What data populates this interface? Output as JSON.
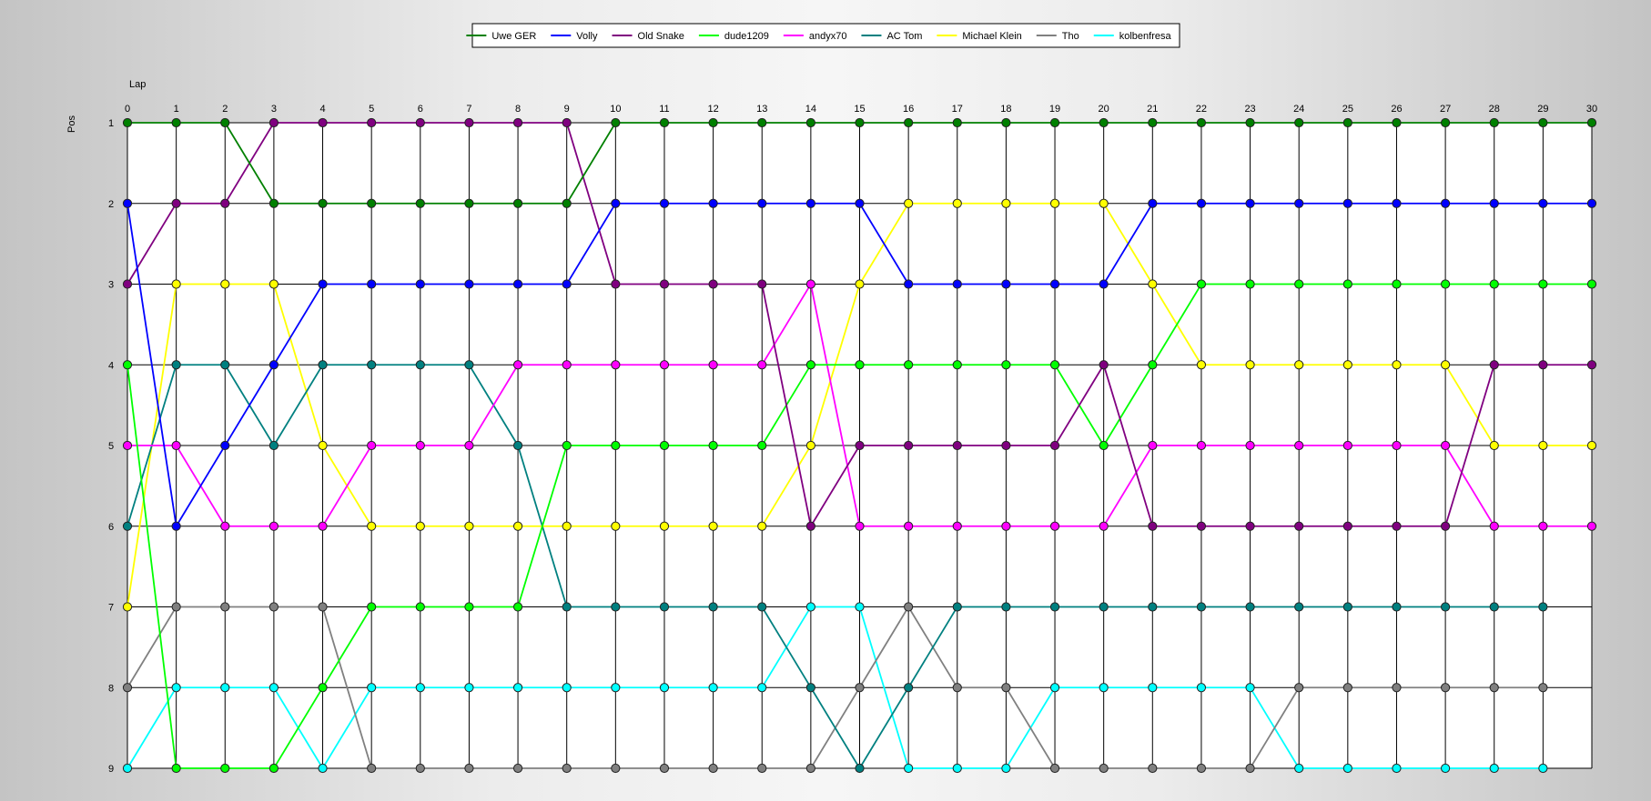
{
  "chart_data": {
    "type": "line",
    "xlabel": "Lap",
    "ylabel": "Pos",
    "x": [
      0,
      1,
      2,
      3,
      4,
      5,
      6,
      7,
      8,
      9,
      10,
      11,
      12,
      13,
      14,
      15,
      16,
      17,
      18,
      19,
      20,
      21,
      22,
      23,
      24,
      25,
      26,
      27,
      28,
      29,
      30
    ],
    "xlim": [
      0,
      30
    ],
    "ylim": [
      1,
      9
    ],
    "y_inverted": true,
    "yticks": [
      1,
      2,
      3,
      4,
      5,
      6,
      7,
      8,
      9
    ],
    "grid": true,
    "legend_position": "top-center",
    "series": [
      {
        "name": "Uwe GER",
        "color": "#008000",
        "values": [
          1,
          1,
          1,
          2,
          2,
          2,
          2,
          2,
          2,
          2,
          1,
          1,
          1,
          1,
          1,
          1,
          1,
          1,
          1,
          1,
          1,
          1,
          1,
          1,
          1,
          1,
          1,
          1,
          1,
          1,
          1
        ]
      },
      {
        "name": "Volly",
        "color": "#0000ff",
        "values": [
          2,
          6,
          5,
          4,
          3,
          3,
          3,
          3,
          3,
          3,
          2,
          2,
          2,
          2,
          2,
          2,
          3,
          3,
          3,
          3,
          3,
          2,
          2,
          2,
          2,
          2,
          2,
          2,
          2,
          2,
          2
        ]
      },
      {
        "name": "Old Snake",
        "color": "#800080",
        "values": [
          3,
          2,
          2,
          1,
          1,
          1,
          1,
          1,
          1,
          1,
          3,
          3,
          3,
          3,
          6,
          5,
          5,
          5,
          5,
          5,
          4,
          6,
          6,
          6,
          6,
          6,
          6,
          6,
          4,
          4,
          4
        ]
      },
      {
        "name": "dude1209",
        "color": "#00ff00",
        "values": [
          4,
          9,
          9,
          9,
          8,
          7,
          7,
          7,
          7,
          5,
          5,
          5,
          5,
          5,
          4,
          4,
          4,
          4,
          4,
          4,
          5,
          4,
          3,
          3,
          3,
          3,
          3,
          3,
          3,
          3,
          3
        ]
      },
      {
        "name": "andyx70",
        "color": "#ff00ff",
        "values": [
          5,
          5,
          6,
          6,
          6,
          5,
          5,
          5,
          4,
          4,
          4,
          4,
          4,
          4,
          3,
          6,
          6,
          6,
          6,
          6,
          6,
          5,
          5,
          5,
          5,
          5,
          5,
          5,
          6,
          6,
          6
        ]
      },
      {
        "name": "AC Tom",
        "color": "#008080",
        "values": [
          6,
          4,
          4,
          5,
          4,
          4,
          4,
          4,
          5,
          7,
          7,
          7,
          7,
          7,
          8,
          9,
          8,
          7,
          7,
          7,
          7,
          7,
          7,
          7,
          7,
          7,
          7,
          7,
          7,
          7,
          null
        ]
      },
      {
        "name": "Michael Klein",
        "color": "#ffff00",
        "values": [
          7,
          3,
          3,
          3,
          5,
          6,
          6,
          6,
          6,
          6,
          6,
          6,
          6,
          6,
          5,
          3,
          2,
          2,
          2,
          2,
          2,
          3,
          4,
          4,
          4,
          4,
          4,
          4,
          5,
          5,
          5
        ]
      },
      {
        "name": "Tho",
        "color": "#808080",
        "values": [
          8,
          7,
          7,
          7,
          7,
          9,
          9,
          9,
          9,
          9,
          9,
          9,
          9,
          9,
          9,
          8,
          7,
          8,
          8,
          9,
          9,
          9,
          9,
          9,
          8,
          8,
          8,
          8,
          8,
          8,
          null
        ]
      },
      {
        "name": "kolbenfresa",
        "color": "#00ffff",
        "values": [
          9,
          8,
          8,
          8,
          9,
          8,
          8,
          8,
          8,
          8,
          8,
          8,
          8,
          8,
          7,
          7,
          9,
          9,
          9,
          8,
          8,
          8,
          8,
          8,
          9,
          9,
          9,
          9,
          9,
          9,
          null
        ]
      }
    ]
  }
}
